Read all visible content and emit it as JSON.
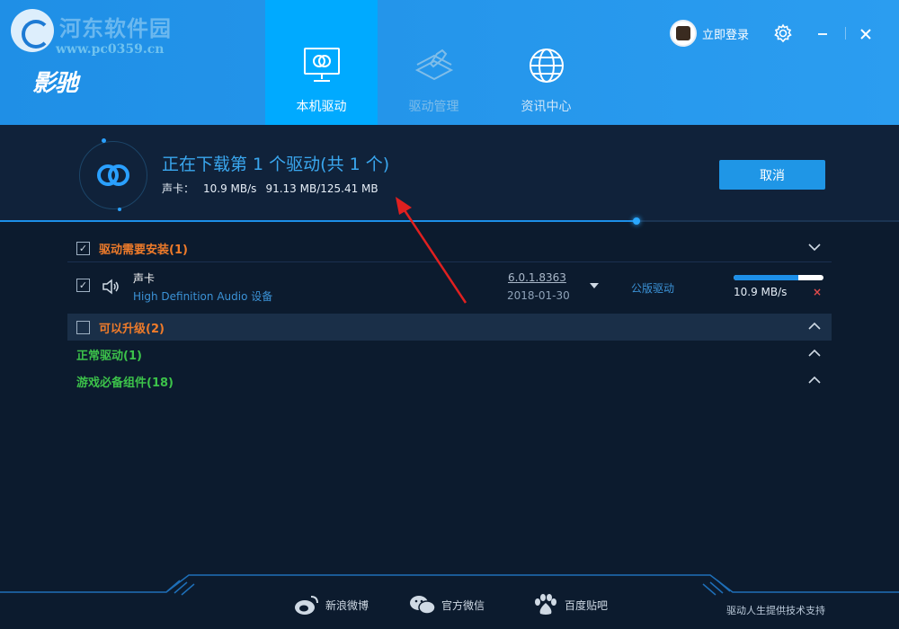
{
  "watermark": {
    "title": "河东软件园",
    "url": "www.pc0359.cn"
  },
  "brand": "影驰",
  "nav": [
    {
      "label": "本机驱动",
      "icon": "monitor-icon",
      "active": true
    },
    {
      "label": "驱动管理",
      "icon": "wrench-icon",
      "active": false
    },
    {
      "label": "资讯中心",
      "icon": "globe-icon",
      "active": false
    }
  ],
  "header": {
    "login_label": "立即登录",
    "settings_icon": "gear-icon",
    "minimize_icon": "minimize-icon",
    "close_icon": "close-icon"
  },
  "download": {
    "title": "正在下载第 1 个驱动(共 1 个)",
    "device": "声卡：",
    "speed": "10.9 MB/s",
    "progress_text": "91.13 MB/125.41 MB",
    "progress": 0.708,
    "cancel_label": "取消"
  },
  "sections": {
    "need_install": {
      "title": "驱动需要安装(1)",
      "checked": true
    },
    "upgradable": {
      "title": "可以升级(2)",
      "checked": false
    },
    "normal": {
      "title": "正常驱动(1)"
    },
    "game": {
      "title": "游戏必备组件(18)"
    }
  },
  "driver_row": {
    "name": "声卡",
    "subtitle": "High Definition Audio 设备",
    "version": "6.0.1.8363",
    "date": "2018-01-30",
    "type": "公版驱动",
    "speed": "10.9 MB/s",
    "progress": 0.72,
    "remove": "×"
  },
  "footer": {
    "links": [
      {
        "label": "新浪微博",
        "icon": "weibo-icon"
      },
      {
        "label": "官方微信",
        "icon": "wechat-icon"
      },
      {
        "label": "百度贴吧",
        "icon": "baidu-tieba-icon"
      }
    ],
    "support": "驱动人生提供技术支持"
  },
  "colors": {
    "header_bg": "#2b9df0",
    "active_tab": "#00aaff",
    "body_bg": "#0c1b2e",
    "accent_blue": "#3aa7ef",
    "orange": "#ef7b2a",
    "green": "#3cc24a"
  }
}
